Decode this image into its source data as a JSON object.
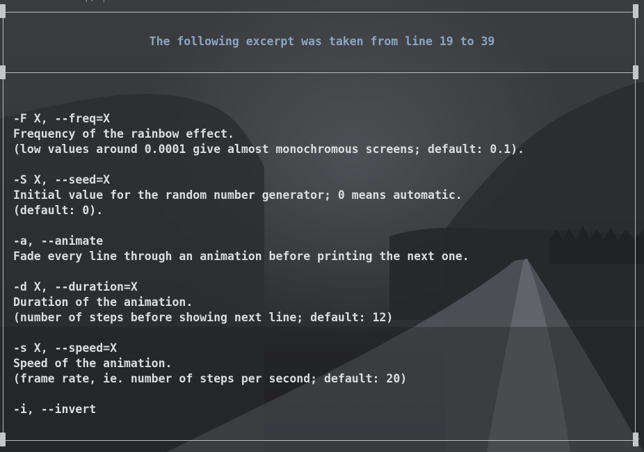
{
  "header": {
    "title": "The following excerpt was taken from line 19 to 39"
  },
  "top_fragment": "|, |",
  "excerpt_lines": [
    "-F X, --freq=X",
    "Frequency of the rainbow effect.",
    "(low values around 0.0001 give almost monochromous screens; default: 0.1).",
    "",
    "-S X, --seed=X",
    "Initial value for the random number generator; 0 means automatic.",
    "(default: 0).",
    "",
    "-a, --animate",
    "Fade every line through an animation before printing the next one.",
    "",
    "-d X, --duration=X",
    "Duration of the animation.",
    "(number of steps before showing next line; default: 12)",
    "",
    "-s X, --speed=X",
    "Speed of the animation.",
    "(frame rate, ie. number of steps per second; default: 20)",
    "",
    "-i, --invert"
  ],
  "colors": {
    "title": "#8ca6c4",
    "text": "#dcdde0",
    "frame": "#b9bcbf"
  }
}
